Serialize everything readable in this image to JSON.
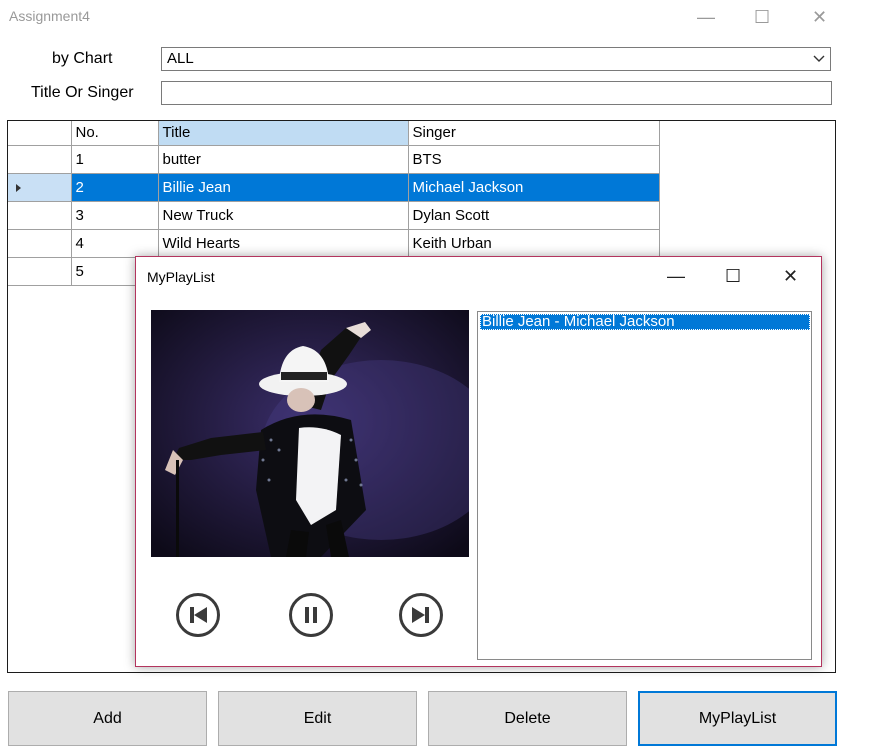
{
  "window": {
    "title": "Assignment4",
    "controls": {
      "minimize": "—",
      "maximize": "☐",
      "close": "✕"
    }
  },
  "form": {
    "chart_label": "by Chart",
    "chart_value": "ALL",
    "search_label": "Title Or Singer",
    "search_value": ""
  },
  "grid": {
    "columns": [
      "No.",
      "Title",
      "Singer"
    ],
    "rows": [
      {
        "no": "1",
        "title": "butter",
        "singer": "BTS"
      },
      {
        "no": "2",
        "title": "Billie Jean",
        "singer": "Michael Jackson"
      },
      {
        "no": "3",
        "title": "New Truck",
        "singer": "Dylan Scott"
      },
      {
        "no": "4",
        "title": "Wild Hearts",
        "singer": "Keith Urban"
      },
      {
        "no": "5",
        "title": "",
        "singer": ""
      }
    ],
    "selected_row": 2
  },
  "buttons": {
    "add": "Add",
    "edit": "Edit",
    "delete": "Delete",
    "playlist": "MyPlayList"
  },
  "popup": {
    "title": "MyPlayList",
    "controls": {
      "minimize": "—",
      "maximize": "☐",
      "close": "✕"
    },
    "playlist_items": [
      "Billie Jean - Michael Jackson"
    ],
    "player_icons": [
      "previous-track-icon",
      "pause-icon",
      "next-track-icon"
    ]
  },
  "colors": {
    "selection": "#0078d7",
    "popup_border": "#b3345e"
  }
}
